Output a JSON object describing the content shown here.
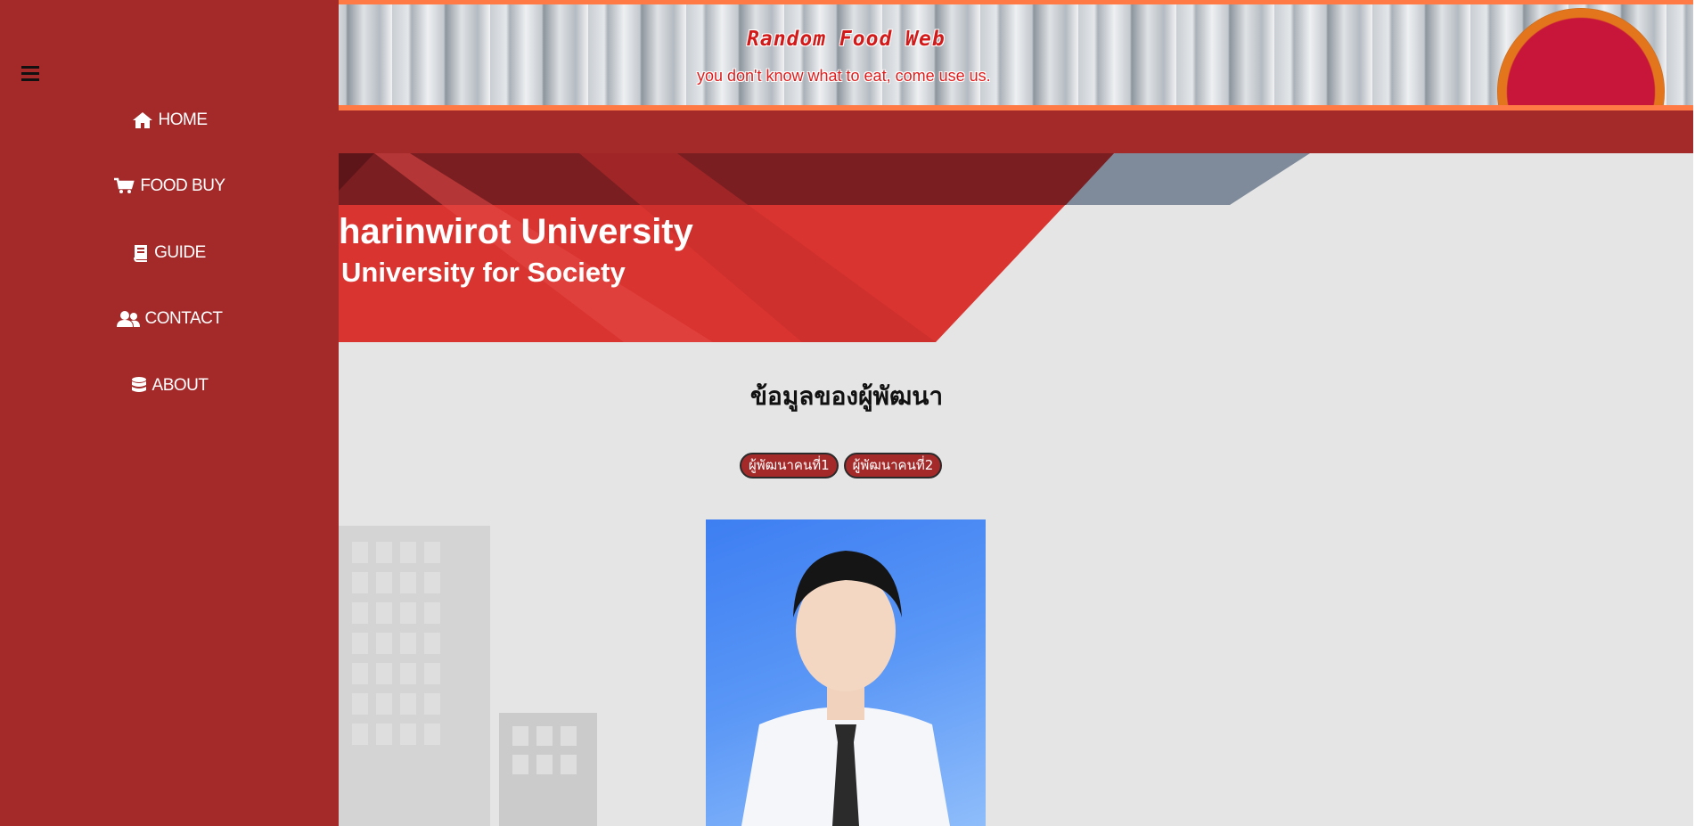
{
  "banner": {
    "title": "Random Food Web",
    "subtitle": "you don't know what to eat, come use us."
  },
  "hero": {
    "line1": "harinwirot University",
    "line2": "University for Society"
  },
  "developers": {
    "heading": "ข้อมูลของผู้พัฒนา",
    "tabs": [
      "ผู้พัฒนาคนที่1",
      "ผู้พัฒนาคนที่2"
    ]
  },
  "sidebar": {
    "menu_icon": "hamburger-icon",
    "items": [
      {
        "label": "HOME",
        "icon": "home-icon"
      },
      {
        "label": "FOOD BUY",
        "icon": "cart-icon"
      },
      {
        "label": "GUIDE",
        "icon": "book-icon"
      },
      {
        "label": "CONTACT",
        "icon": "users-icon"
      },
      {
        "label": "ABOUT",
        "icon": "database-icon"
      }
    ]
  },
  "colors": {
    "primary_red": "#a42a2a",
    "banner_border": "#ff7a45",
    "page_bg": "#e5e5e5",
    "hero_red": "#d9342f",
    "hero_slate": "#7f8a9a"
  }
}
